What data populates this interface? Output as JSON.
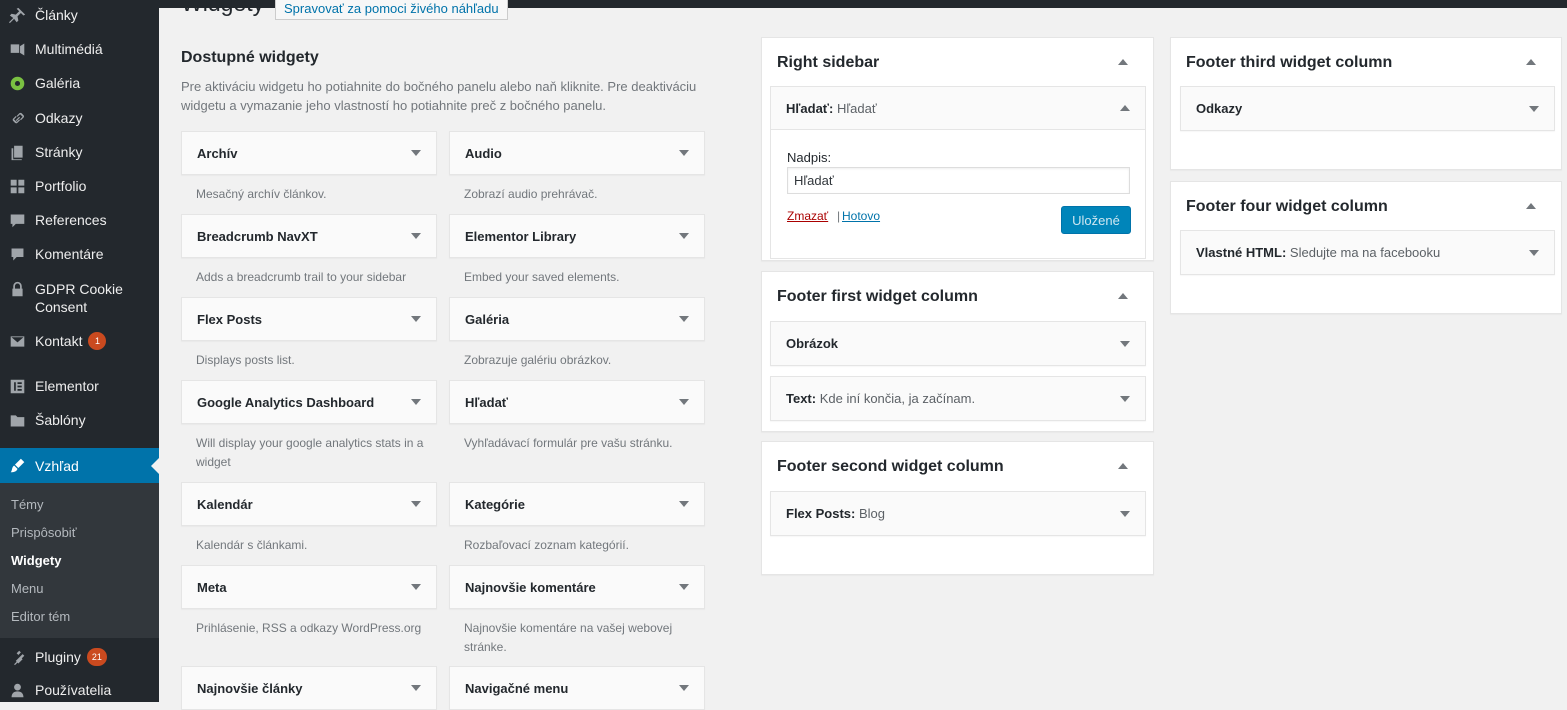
{
  "sidebar": {
    "items": [
      {
        "label": "Články",
        "icon": "pushpin-icon"
      },
      {
        "label": "Multimédiá",
        "icon": "media-icon"
      },
      {
        "label": "Galéria",
        "icon": "gallery-icon"
      },
      {
        "label": "Odkazy",
        "icon": "link-icon"
      },
      {
        "label": "Stránky",
        "icon": "pages-icon"
      },
      {
        "label": "Portfolio",
        "icon": "grid-icon"
      },
      {
        "label": "References",
        "icon": "speech-bubbles-icon"
      },
      {
        "label": "Komentáre",
        "icon": "comment-icon"
      },
      {
        "label": "GDPR Cookie Consent",
        "icon": "lock-icon"
      },
      {
        "label": "Kontakt",
        "icon": "envelope-icon",
        "badge": "1"
      },
      {
        "label": "Elementor",
        "icon": "elementor-icon"
      },
      {
        "label": "Šablóny",
        "icon": "folder-icon"
      },
      {
        "label": "Vzhľad",
        "icon": "brush-icon"
      },
      {
        "label": "Pluginy",
        "icon": "plugin-icon",
        "badge": "21"
      },
      {
        "label": "Používatelia",
        "icon": "user-icon"
      }
    ],
    "submenu": [
      "Témy",
      "Prispôsobiť",
      "Widgety",
      "Menu",
      "Editor tém"
    ],
    "active_color": "#0073aa",
    "badge_color": "#ca4a1f"
  },
  "header": {
    "title": "Widgety",
    "manage_live": "Spravovať za pomoci živého náhľadu"
  },
  "available": {
    "title": "Dostupné widgety",
    "description": "Pre aktiváciu widgetu ho potiahnite do bočného panelu alebo naň kliknite. Pre deaktiváciu widgetu a vymazanie jeho vlastností ho potiahnite preč z bočného panelu.",
    "widgets": [
      {
        "name": "Archív",
        "desc": "Mesačný archív článkov."
      },
      {
        "name": "Audio",
        "desc": "Zobrazí audio prehrávač."
      },
      {
        "name": "Breadcrumb NavXT",
        "desc": "Adds a breadcrumb trail to your sidebar"
      },
      {
        "name": "Elementor Library",
        "desc": "Embed your saved elements."
      },
      {
        "name": "Flex Posts",
        "desc": "Displays posts list."
      },
      {
        "name": "Galéria",
        "desc": "Zobrazuje galériu obrázkov."
      },
      {
        "name": "Google Analytics Dashboard",
        "desc": "Will display your google analytics stats in a widget"
      },
      {
        "name": "Hľadať",
        "desc": "Vyhľadávací formulár pre vašu stránku."
      },
      {
        "name": "Kalendár",
        "desc": "Kalendár s článkami."
      },
      {
        "name": "Kategórie",
        "desc": "Rozbaľovací zoznam kategórií."
      },
      {
        "name": "Meta",
        "desc": "Prihlásenie, RSS a odkazy WordPress.org"
      },
      {
        "name": "Najnovšie komentáre",
        "desc": "Najnovšie komentáre na vašej webovej stránke."
      },
      {
        "name": "Najnovšie články",
        "desc": ""
      },
      {
        "name": "Navigačné menu",
        "desc": ""
      }
    ]
  },
  "right_sidebar": {
    "title": "Right sidebar",
    "open_widget": {
      "title": "Hľadať:",
      "subtitle": "Hľadať",
      "field_label": "Nadpis:",
      "field_value": "Hľadať",
      "delete_label": "Zmazať",
      "separator": "|",
      "done_label": "Hotovo",
      "save_label": "Uložené"
    }
  },
  "footer_first": {
    "title": "Footer first widget column",
    "widgets": [
      {
        "title": "Obrázok",
        "subtitle": ""
      },
      {
        "title": "Text:",
        "subtitle": "Kde iní končia, ja začínam."
      }
    ]
  },
  "footer_second": {
    "title": "Footer second widget column",
    "widgets": [
      {
        "title": "Flex Posts:",
        "subtitle": "Blog"
      }
    ]
  },
  "footer_third": {
    "title": "Footer third widget column",
    "widgets": [
      {
        "title": "Odkazy",
        "subtitle": ""
      }
    ]
  },
  "footer_four": {
    "title": "Footer four widget column",
    "widgets": [
      {
        "title": "Vlastné HTML:",
        "subtitle": "Sledujte ma na facebooku"
      }
    ]
  }
}
